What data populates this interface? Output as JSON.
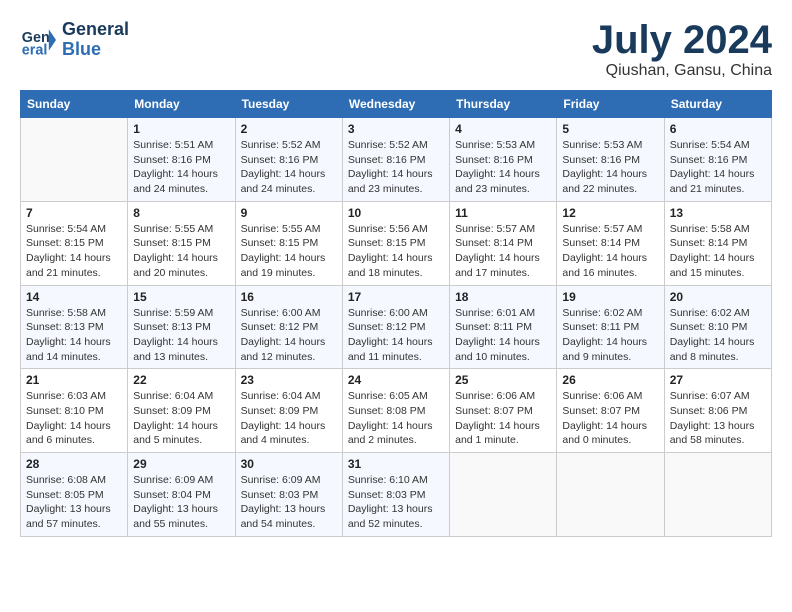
{
  "header": {
    "logo_line1": "General",
    "logo_line2": "Blue",
    "month_year": "July 2024",
    "location": "Qiushan, Gansu, China"
  },
  "weekdays": [
    "Sunday",
    "Monday",
    "Tuesday",
    "Wednesday",
    "Thursday",
    "Friday",
    "Saturday"
  ],
  "weeks": [
    [
      {
        "day": "",
        "info": ""
      },
      {
        "day": "1",
        "info": "Sunrise: 5:51 AM\nSunset: 8:16 PM\nDaylight: 14 hours\nand 24 minutes."
      },
      {
        "day": "2",
        "info": "Sunrise: 5:52 AM\nSunset: 8:16 PM\nDaylight: 14 hours\nand 24 minutes."
      },
      {
        "day": "3",
        "info": "Sunrise: 5:52 AM\nSunset: 8:16 PM\nDaylight: 14 hours\nand 23 minutes."
      },
      {
        "day": "4",
        "info": "Sunrise: 5:53 AM\nSunset: 8:16 PM\nDaylight: 14 hours\nand 23 minutes."
      },
      {
        "day": "5",
        "info": "Sunrise: 5:53 AM\nSunset: 8:16 PM\nDaylight: 14 hours\nand 22 minutes."
      },
      {
        "day": "6",
        "info": "Sunrise: 5:54 AM\nSunset: 8:16 PM\nDaylight: 14 hours\nand 21 minutes."
      }
    ],
    [
      {
        "day": "7",
        "info": "Sunrise: 5:54 AM\nSunset: 8:15 PM\nDaylight: 14 hours\nand 21 minutes."
      },
      {
        "day": "8",
        "info": "Sunrise: 5:55 AM\nSunset: 8:15 PM\nDaylight: 14 hours\nand 20 minutes."
      },
      {
        "day": "9",
        "info": "Sunrise: 5:55 AM\nSunset: 8:15 PM\nDaylight: 14 hours\nand 19 minutes."
      },
      {
        "day": "10",
        "info": "Sunrise: 5:56 AM\nSunset: 8:15 PM\nDaylight: 14 hours\nand 18 minutes."
      },
      {
        "day": "11",
        "info": "Sunrise: 5:57 AM\nSunset: 8:14 PM\nDaylight: 14 hours\nand 17 minutes."
      },
      {
        "day": "12",
        "info": "Sunrise: 5:57 AM\nSunset: 8:14 PM\nDaylight: 14 hours\nand 16 minutes."
      },
      {
        "day": "13",
        "info": "Sunrise: 5:58 AM\nSunset: 8:14 PM\nDaylight: 14 hours\nand 15 minutes."
      }
    ],
    [
      {
        "day": "14",
        "info": "Sunrise: 5:58 AM\nSunset: 8:13 PM\nDaylight: 14 hours\nand 14 minutes."
      },
      {
        "day": "15",
        "info": "Sunrise: 5:59 AM\nSunset: 8:13 PM\nDaylight: 14 hours\nand 13 minutes."
      },
      {
        "day": "16",
        "info": "Sunrise: 6:00 AM\nSunset: 8:12 PM\nDaylight: 14 hours\nand 12 minutes."
      },
      {
        "day": "17",
        "info": "Sunrise: 6:00 AM\nSunset: 8:12 PM\nDaylight: 14 hours\nand 11 minutes."
      },
      {
        "day": "18",
        "info": "Sunrise: 6:01 AM\nSunset: 8:11 PM\nDaylight: 14 hours\nand 10 minutes."
      },
      {
        "day": "19",
        "info": "Sunrise: 6:02 AM\nSunset: 8:11 PM\nDaylight: 14 hours\nand 9 minutes."
      },
      {
        "day": "20",
        "info": "Sunrise: 6:02 AM\nSunset: 8:10 PM\nDaylight: 14 hours\nand 8 minutes."
      }
    ],
    [
      {
        "day": "21",
        "info": "Sunrise: 6:03 AM\nSunset: 8:10 PM\nDaylight: 14 hours\nand 6 minutes."
      },
      {
        "day": "22",
        "info": "Sunrise: 6:04 AM\nSunset: 8:09 PM\nDaylight: 14 hours\nand 5 minutes."
      },
      {
        "day": "23",
        "info": "Sunrise: 6:04 AM\nSunset: 8:09 PM\nDaylight: 14 hours\nand 4 minutes."
      },
      {
        "day": "24",
        "info": "Sunrise: 6:05 AM\nSunset: 8:08 PM\nDaylight: 14 hours\nand 2 minutes."
      },
      {
        "day": "25",
        "info": "Sunrise: 6:06 AM\nSunset: 8:07 PM\nDaylight: 14 hours\nand 1 minute."
      },
      {
        "day": "26",
        "info": "Sunrise: 6:06 AM\nSunset: 8:07 PM\nDaylight: 14 hours\nand 0 minutes."
      },
      {
        "day": "27",
        "info": "Sunrise: 6:07 AM\nSunset: 8:06 PM\nDaylight: 13 hours\nand 58 minutes."
      }
    ],
    [
      {
        "day": "28",
        "info": "Sunrise: 6:08 AM\nSunset: 8:05 PM\nDaylight: 13 hours\nand 57 minutes."
      },
      {
        "day": "29",
        "info": "Sunrise: 6:09 AM\nSunset: 8:04 PM\nDaylight: 13 hours\nand 55 minutes."
      },
      {
        "day": "30",
        "info": "Sunrise: 6:09 AM\nSunset: 8:03 PM\nDaylight: 13 hours\nand 54 minutes."
      },
      {
        "day": "31",
        "info": "Sunrise: 6:10 AM\nSunset: 8:03 PM\nDaylight: 13 hours\nand 52 minutes."
      },
      {
        "day": "",
        "info": ""
      },
      {
        "day": "",
        "info": ""
      },
      {
        "day": "",
        "info": ""
      }
    ]
  ]
}
